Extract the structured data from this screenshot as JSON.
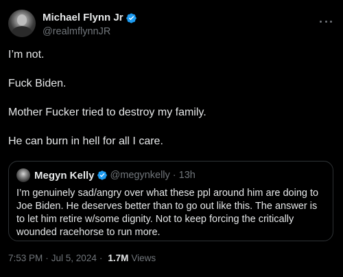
{
  "author": {
    "display_name": "Michael Flynn Jr",
    "handle": "@realmflynnJR",
    "verified": true
  },
  "tweet_lines": [
    "I’m not.",
    "Fuck Biden.",
    "Mother Fucker tried to destroy my family.",
    "He can burn in hell for all I care."
  ],
  "quoted": {
    "display_name": "Megyn Kelly",
    "handle": "@megynkelly",
    "dot": "·",
    "time": "13h",
    "text": "I’m genuinely sad/angry over what these ppl around him are doing to Joe Biden. He deserves better than to go out like this. The answer is to let him retire w/some dignity. Not to keep forcing the critically wounded racehorse to run more."
  },
  "meta": {
    "time": "7:53 PM",
    "dot1": "·",
    "date": "Jul 5, 2024",
    "dot2": "·",
    "views_count": "1.7M",
    "views_label": "Views"
  },
  "colors": {
    "background": "#000000",
    "text": "#e7e9ea",
    "secondary": "#71767b",
    "verified_blue": "#1d9bf0",
    "border": "#2f3336"
  },
  "icons": {
    "verified": "verified-badge-icon",
    "more": "more-horizontal-icon"
  }
}
